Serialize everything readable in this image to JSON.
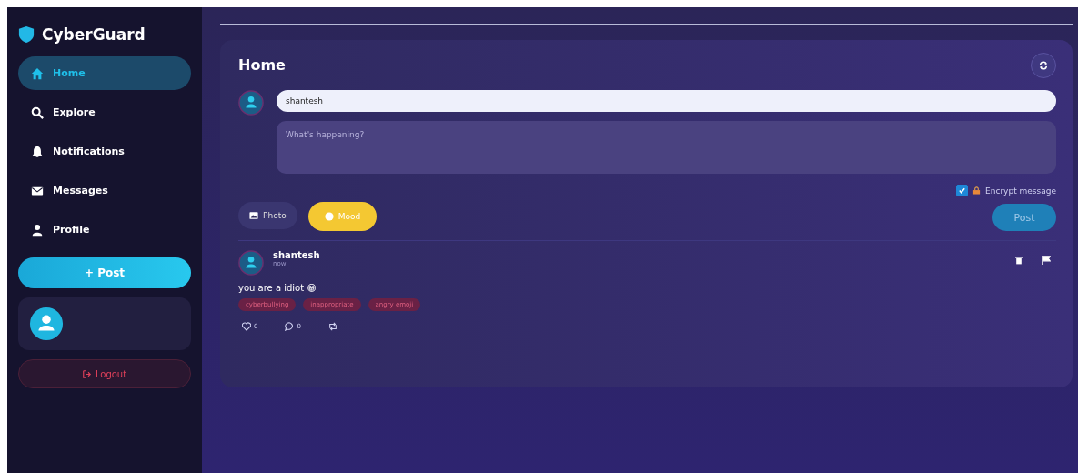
{
  "brand": {
    "name": "CyberGuard"
  },
  "nav": [
    {
      "label": "Home",
      "kind": "home",
      "selected": true
    },
    {
      "label": "Explore",
      "kind": "search",
      "selected": false
    },
    {
      "label": "Notifications",
      "kind": "bell",
      "selected": false
    },
    {
      "label": "Messages",
      "kind": "mail",
      "selected": false
    },
    {
      "label": "Profile",
      "kind": "user",
      "selected": false
    }
  ],
  "post_button": "+ Post",
  "logout": "Logout",
  "feed": {
    "title": "Home",
    "composer": {
      "username": "shantesh",
      "placeholder": "What's happening?",
      "photo": "Photo",
      "mood": "Mood",
      "encrypt": {
        "label": "Encrypt message",
        "checked": true
      },
      "post": "Post"
    },
    "posts": [
      {
        "author": "shantesh",
        "time": "now",
        "text": "you are a idiot 😁",
        "tags": [
          "cyberbullying",
          "inappropriate",
          "angry emoji"
        ],
        "likes": "0",
        "comments": "0"
      }
    ]
  }
}
